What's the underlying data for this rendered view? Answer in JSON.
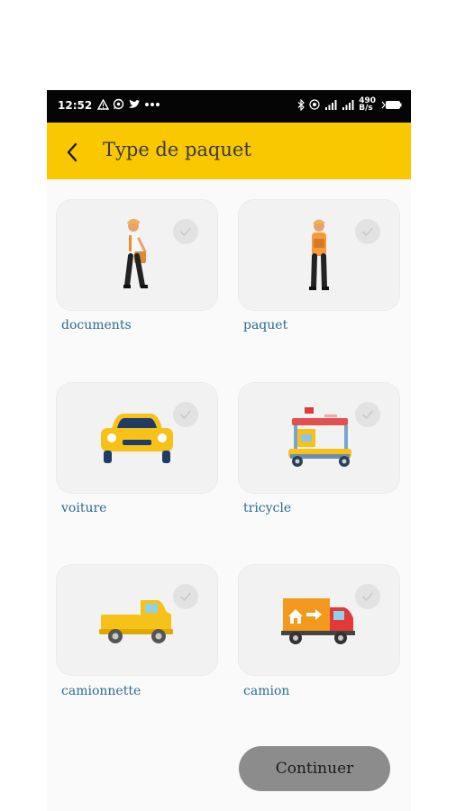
{
  "status_bar": {
    "time": "12:52",
    "data_rate": "490",
    "data_unit": "B/s"
  },
  "header": {
    "title": "Type de paquet"
  },
  "package_types": [
    {
      "label": "documents",
      "icon": "courier-with-bag-icon",
      "selected": false
    },
    {
      "label": "paquet",
      "icon": "courier-with-box-icon",
      "selected": false
    },
    {
      "label": "voiture",
      "icon": "car-icon",
      "selected": false
    },
    {
      "label": "tricycle",
      "icon": "tricycle-icon",
      "selected": false
    },
    {
      "label": "camionnette",
      "icon": "pickup-truck-icon",
      "selected": false
    },
    {
      "label": "camion",
      "icon": "moving-truck-icon",
      "selected": false
    }
  ],
  "footer": {
    "continue_label": "Continuer"
  },
  "colors": {
    "accent": "#f9c800",
    "label": "#2e6b8f",
    "button": "#8c8c8c",
    "card": "#f2f2f2"
  }
}
